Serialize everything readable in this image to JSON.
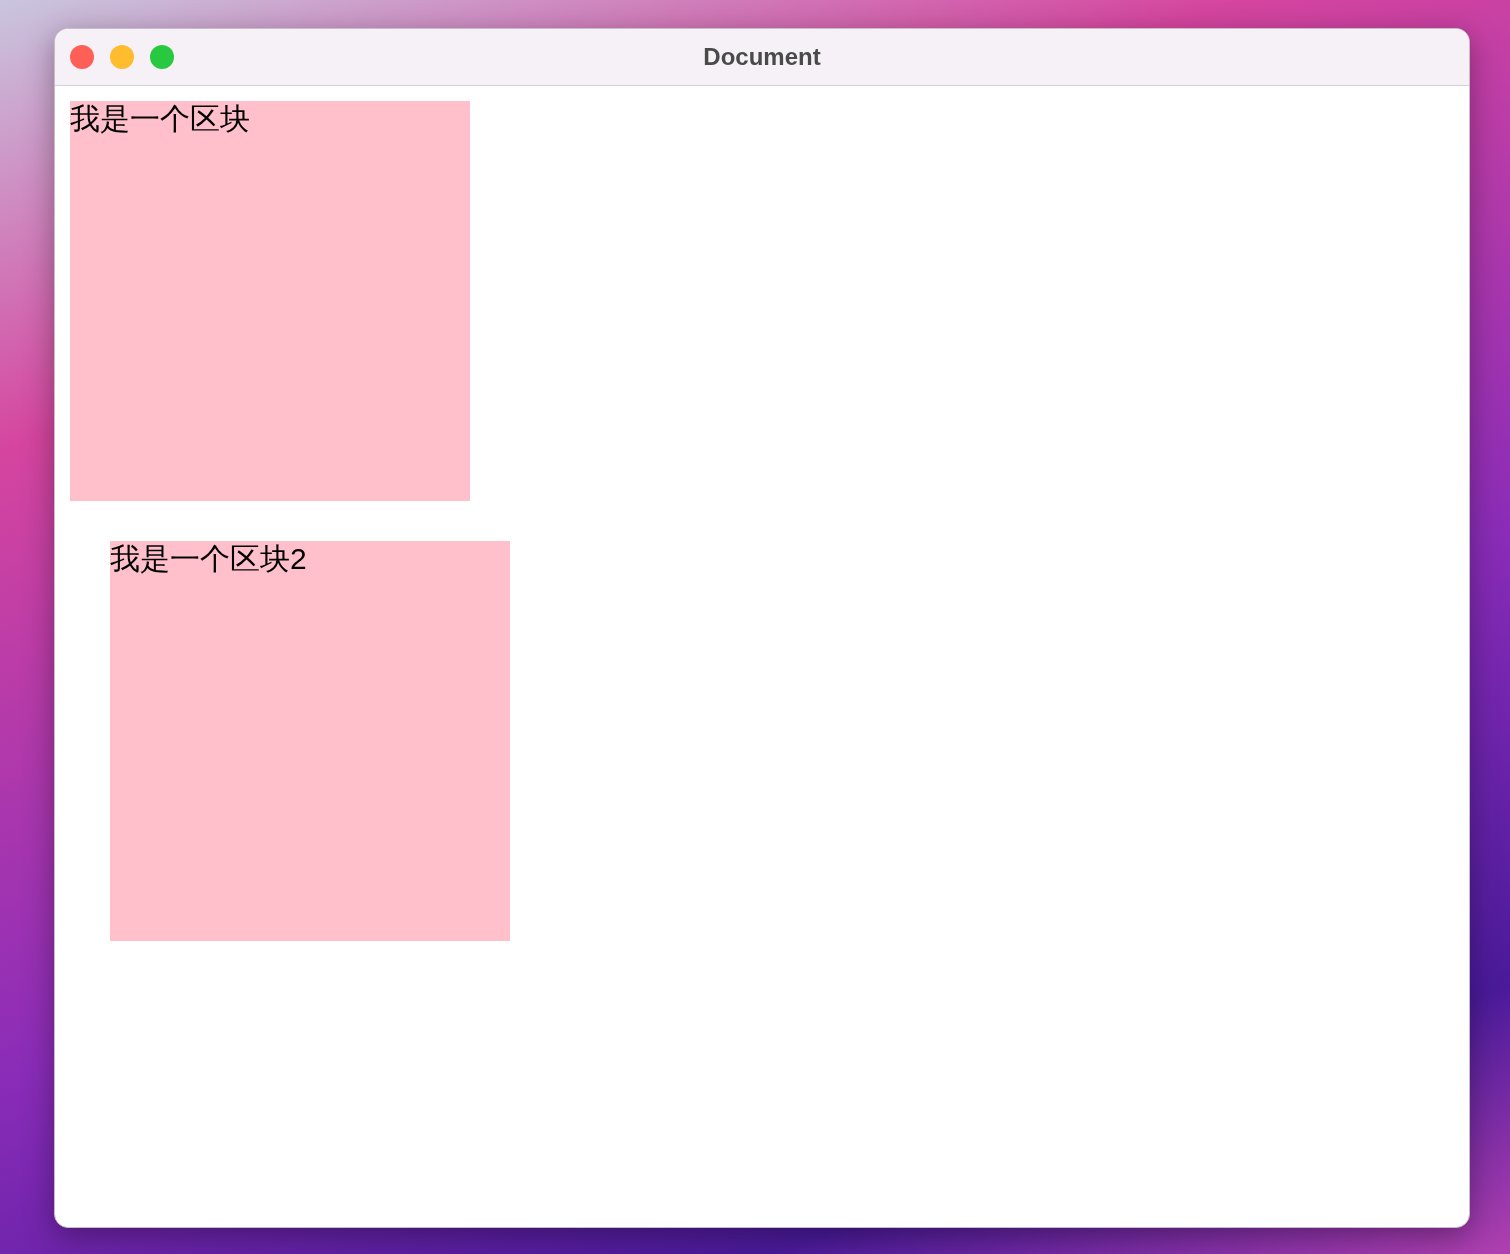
{
  "window": {
    "title": "Document"
  },
  "blocks": [
    {
      "text": "我是一个区块"
    },
    {
      "text": "我是一个区块2"
    }
  ]
}
